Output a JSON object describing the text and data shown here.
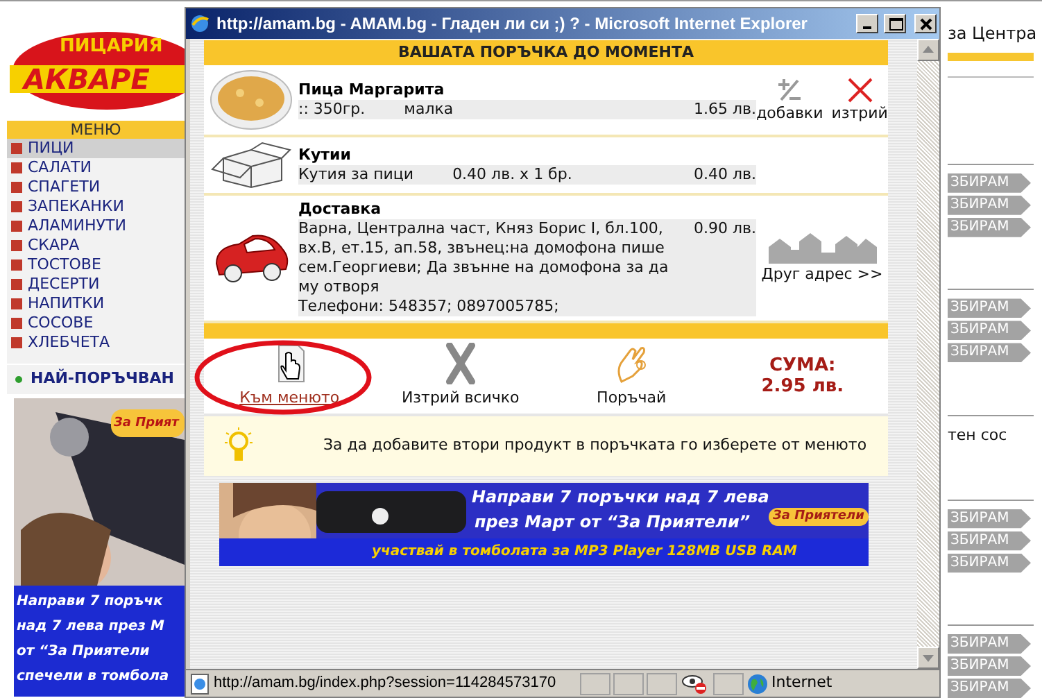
{
  "page": {
    "logo": {
      "top": "ПИЦАРИЯ",
      "name": "АКВАРЕ"
    },
    "menu": {
      "title": "МЕНЮ",
      "items": [
        {
          "label": "ПИЦИ",
          "selected": true
        },
        {
          "label": "САЛАТИ",
          "selected": false
        },
        {
          "label": "СПАГЕТИ",
          "selected": false
        },
        {
          "label": "ЗАПЕКАНКИ",
          "selected": false
        },
        {
          "label": "АЛАМИНУТИ",
          "selected": false
        },
        {
          "label": "СКАРА",
          "selected": false
        },
        {
          "label": "ТОСТОВЕ",
          "selected": false
        },
        {
          "label": "ДЕСЕРТИ",
          "selected": false
        },
        {
          "label": "НАПИТКИ",
          "selected": false
        },
        {
          "label": "СОСОВЕ",
          "selected": false
        },
        {
          "label": "ХЛЕБЧЕТА",
          "selected": false
        }
      ]
    },
    "popular_heading": "НАЙ-ПОРЪЧВАН",
    "side_banner": {
      "kind": "picture",
      "badge": "За Прият",
      "lines": [
        "Направи 7 поръчк",
        "над 7 лева през М",
        "от “За Приятели",
        "спечели в томбола"
      ]
    },
    "right_column": {
      "heading": "за Центра",
      "blocks": [
        {
          "kind": "buttons",
          "labels": [
            "ЗБИРАМ",
            "ЗБИРАМ",
            "ЗБИРАМ"
          ]
        },
        {
          "kind": "buttons",
          "labels": [
            "ЗБИРАМ",
            "ЗБИРАМ",
            "ЗБИРАМ"
          ]
        },
        {
          "kind": "text",
          "text": "тен сос"
        },
        {
          "kind": "buttons",
          "labels": [
            "ЗБИРАМ",
            "ЗБИРАМ",
            "ЗБИРАМ"
          ]
        },
        {
          "kind": "buttons",
          "labels": [
            "ЗБИРАМ",
            "ЗБИРАМ",
            "ЗБИРАМ"
          ]
        }
      ]
    }
  },
  "window": {
    "title": "http://amam.bg - AMAM.bg - Гладен ли си ;) ? - Microsoft Internet Explorer",
    "order": {
      "heading": "ВАШАТА ПОРЪЧКА ДО МОМЕНТА",
      "items": [
        {
          "kind": "pizza",
          "name": "Пица Маргарита",
          "details": [
            ":: 350гр.",
            "малка"
          ],
          "price": "1.65 лв.",
          "actions": [
            "добавки",
            "изтрий"
          ]
        },
        {
          "kind": "box",
          "name": "Кутии",
          "details": [
            "Кутия за пици",
            "0.40 лв. x 1 бр."
          ],
          "price": "0.40 лв."
        },
        {
          "kind": "delivery",
          "name": "Доставка",
          "address": "Варна, Централна част, Княз Борис I, бл.100, вх.В, ет.15, ап.58, звънец:на домофона пише сем.Георгиеви; Да звънне на домофона за да му отворя",
          "phones": "Телефони: 548357; 0897005785;",
          "price": "0.90 лв.",
          "link": "Друг адрес >>"
        }
      ]
    },
    "actions": [
      {
        "kind": "menu",
        "label": "Към менюто"
      },
      {
        "kind": "clear",
        "label": "Изтрий всичко"
      },
      {
        "kind": "order",
        "label": "Поръчай"
      }
    ],
    "total": {
      "label": "СУМА:",
      "value": "2.95 лв."
    },
    "tip": "За да добавите втори продукт в поръчката го изберете от менюто",
    "banner": {
      "kind": "picture",
      "badge": "За Приятели",
      "lines": [
        "Направи 7 поръчки над 7 лева",
        "през Март от “За Приятели”",
        "участвай в томболата за MP3 Player 128MB USB RAM"
      ]
    },
    "status_bar": {
      "url": "http://amam.bg/index.php?session=114284573170",
      "zone": "Internet"
    }
  }
}
